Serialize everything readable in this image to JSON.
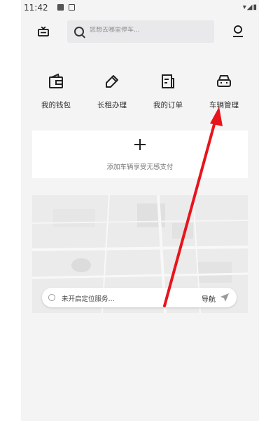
{
  "status_bar": {
    "time": "11:42",
    "right_icons": "▾◢▮"
  },
  "header": {
    "search": {
      "placeholder": "您想去哪里停车..."
    }
  },
  "quick_menu": {
    "items": [
      {
        "label": "我的钱包",
        "icon": "wallet-icon"
      },
      {
        "label": "长租办理",
        "icon": "pen-icon"
      },
      {
        "label": "我的订单",
        "icon": "order-icon"
      },
      {
        "label": "车辆管理",
        "icon": "car-icon"
      }
    ]
  },
  "add_vehicle": {
    "symbol": "+",
    "text": "添加车辆享受无感支付"
  },
  "map": {
    "location_status": "未开启定位服务...",
    "navigate_label": "导航"
  },
  "annotation": {
    "arrow_color": "#e8141b",
    "points_to": "车辆管理"
  }
}
